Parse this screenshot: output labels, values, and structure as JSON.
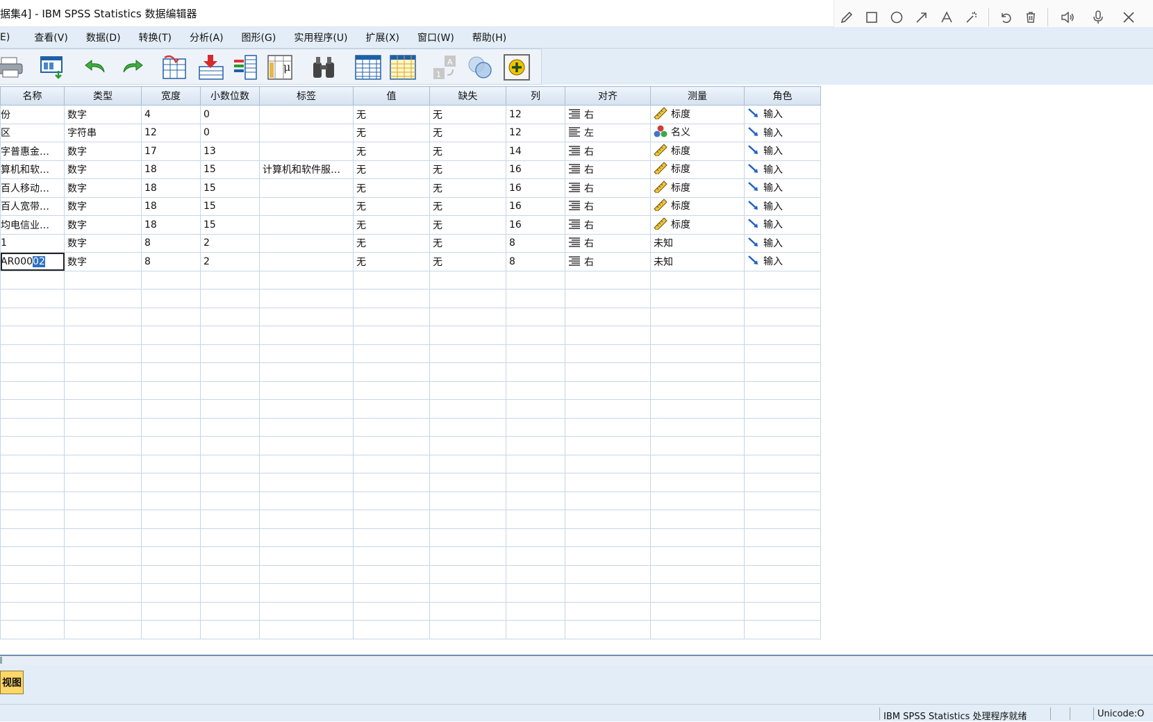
{
  "window": {
    "title": "据集4] - IBM SPSS Statistics 数据编辑器"
  },
  "annotation_toolbar": {
    "tools": [
      "pencil-icon",
      "rectangle-icon",
      "circle-icon",
      "arrow-icon",
      "text-icon",
      "magic-wand-icon",
      "undo-icon",
      "trash-icon",
      "speaker-icon",
      "microphone-icon",
      "close-icon"
    ]
  },
  "menu": {
    "items": [
      "E)",
      "查看(V)",
      "数据(D)",
      "转换(T)",
      "分析(A)",
      "图形(G)",
      "实用程序(U)",
      "扩展(X)",
      "窗口(W)",
      "帮助(H)"
    ]
  },
  "grid": {
    "columns": [
      "名称",
      "类型",
      "宽度",
      "小数位数",
      "标签",
      "值",
      "缺失",
      "列",
      "对齐",
      "测量",
      "角色"
    ],
    "rows": [
      {
        "name": "份",
        "type": "数字",
        "width": "4",
        "decimals": "0",
        "label": "",
        "values": "无",
        "missing": "无",
        "columns": "12",
        "align": "右",
        "align_icon": "align-right-icon",
        "measure": "标度",
        "measure_icon": "ruler-icon",
        "role": "输入"
      },
      {
        "name": "区",
        "type": "字符串",
        "width": "12",
        "decimals": "0",
        "label": "",
        "values": "无",
        "missing": "无",
        "columns": "12",
        "align": "左",
        "align_icon": "align-left-icon",
        "measure": "名义",
        "measure_icon": "nominal-icon",
        "role": "输入"
      },
      {
        "name": "字普惠金…",
        "type": "数字",
        "width": "17",
        "decimals": "13",
        "label": "",
        "values": "无",
        "missing": "无",
        "columns": "14",
        "align": "右",
        "align_icon": "align-right-icon",
        "measure": "标度",
        "measure_icon": "ruler-icon",
        "role": "输入"
      },
      {
        "name": "算机和软…",
        "type": "数字",
        "width": "18",
        "decimals": "15",
        "label": "计算机和软件服…",
        "values": "无",
        "missing": "无",
        "columns": "16",
        "align": "右",
        "align_icon": "align-right-icon",
        "measure": "标度",
        "measure_icon": "ruler-icon",
        "role": "输入"
      },
      {
        "name": "百人移动…",
        "type": "数字",
        "width": "18",
        "decimals": "15",
        "label": "",
        "values": "无",
        "missing": "无",
        "columns": "16",
        "align": "右",
        "align_icon": "align-right-icon",
        "measure": "标度",
        "measure_icon": "ruler-icon",
        "role": "输入"
      },
      {
        "name": "百人宽带…",
        "type": "数字",
        "width": "18",
        "decimals": "15",
        "label": "",
        "values": "无",
        "missing": "无",
        "columns": "16",
        "align": "右",
        "align_icon": "align-right-icon",
        "measure": "标度",
        "measure_icon": "ruler-icon",
        "role": "输入"
      },
      {
        "name": "均电信业…",
        "type": "数字",
        "width": "18",
        "decimals": "15",
        "label": "",
        "values": "无",
        "missing": "无",
        "columns": "16",
        "align": "右",
        "align_icon": "align-right-icon",
        "measure": "标度",
        "measure_icon": "ruler-icon",
        "role": "输入"
      },
      {
        "name": "1",
        "type": "数字",
        "width": "8",
        "decimals": "2",
        "label": "",
        "values": "无",
        "missing": "无",
        "columns": "8",
        "align": "右",
        "align_icon": "align-right-icon",
        "measure": "未知",
        "measure_icon": "",
        "role": "输入"
      },
      {
        "name": "AR000",
        "name_selected": "02",
        "type": "数字",
        "width": "8",
        "decimals": "2",
        "label": "",
        "values": "无",
        "missing": "无",
        "columns": "8",
        "align": "右",
        "align_icon": "align-right-icon",
        "measure": "未知",
        "measure_icon": "",
        "role": "输入"
      }
    ],
    "empty_rows": 20
  },
  "tabs": {
    "active": "视图"
  },
  "status": {
    "message": "IBM SPSS Statistics 处理程序就绪",
    "encoding": "Unicode:O"
  }
}
